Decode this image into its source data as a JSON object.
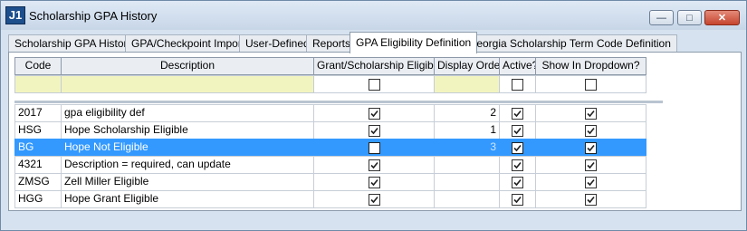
{
  "window": {
    "app_icon": "J1",
    "title": "Scholarship GPA History",
    "controls": {
      "minimize": "—",
      "maximize": "□",
      "close": "✕"
    }
  },
  "tabs": [
    {
      "label": "Scholarship GPA History",
      "active": false
    },
    {
      "label": "GPA/Checkpoint Import",
      "active": false
    },
    {
      "label": "User-Defined",
      "active": false
    },
    {
      "label": "Reports",
      "active": false
    },
    {
      "label": "GPA Eligibility Definition",
      "active": true
    },
    {
      "label": "Georgia Scholarship Term Code Definition",
      "active": false
    }
  ],
  "grid": {
    "columns": {
      "code": "Code",
      "description": "Description",
      "grant": "Grant/Scholarship Eligible",
      "order": "Display Order",
      "active": "Active?",
      "dropdown": "Show In Dropdown?"
    },
    "filter": {
      "code": "",
      "description": "",
      "grant": false,
      "order": "",
      "active": false,
      "dropdown": false
    },
    "rows": [
      {
        "code": "2017",
        "description": "gpa eligibility def",
        "grant": true,
        "order": "2",
        "active": true,
        "dropdown": true,
        "selected": false
      },
      {
        "code": "HSG",
        "description": "Hope Scholarship Eligible",
        "grant": true,
        "order": "1",
        "active": true,
        "dropdown": true,
        "selected": false
      },
      {
        "code": "BG",
        "description": "Hope Not Eligible",
        "grant": false,
        "order": "3",
        "active": true,
        "dropdown": true,
        "selected": true
      },
      {
        "code": "4321",
        "description": "Description = required, can update",
        "grant": true,
        "order": "",
        "active": true,
        "dropdown": true,
        "selected": false
      },
      {
        "code": "ZMSG",
        "description": "Zell Miller Eligible",
        "grant": true,
        "order": "",
        "active": true,
        "dropdown": true,
        "selected": false
      },
      {
        "code": "HGG",
        "description": "Hope Grant Eligible",
        "grant": true,
        "order": "",
        "active": true,
        "dropdown": true,
        "selected": false
      }
    ]
  },
  "colors": {
    "selection": "#3399ff",
    "filter_highlight": "#f2f4c0",
    "header": "#eaeef3"
  }
}
